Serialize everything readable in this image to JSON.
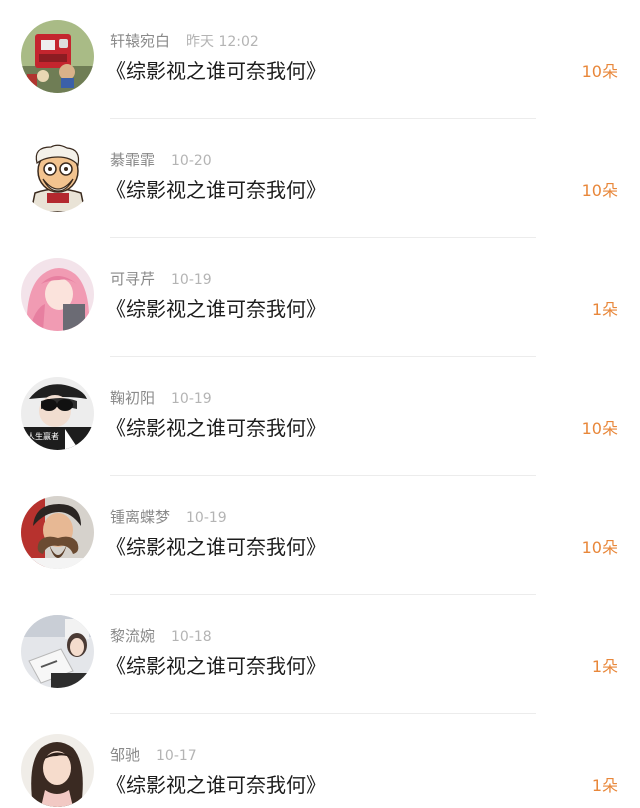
{
  "comments": [
    {
      "user": "轩辕宛白",
      "time": "昨天 12:02",
      "work": "《综影视之谁可奈我何》",
      "gift": "10朵",
      "avatar": "toy-figures-avatar"
    },
    {
      "user": "綦霏霏",
      "time": "10-20",
      "work": "《综影视之谁可奈我何》",
      "gift": "10朵",
      "avatar": "cartoon-old-man-avatar"
    },
    {
      "user": "可寻芹",
      "time": "10-19",
      "work": "《综影视之谁可奈我何》",
      "gift": "1朵",
      "avatar": "pink-hair-anime-girl-avatar"
    },
    {
      "user": "鞠初阳",
      "time": "10-19",
      "work": "《综影视之谁可奈我何》",
      "gift": "10朵",
      "avatar": "sunglasses-person-avatar"
    },
    {
      "user": "锺离蝶梦",
      "time": "10-19",
      "work": "《综影视之谁可奈我何》",
      "gift": "10朵",
      "avatar": "mustache-man-avatar"
    },
    {
      "user": "黎流婉",
      "time": "10-18",
      "work": "《综影视之谁可奈我何》",
      "gift": "1朵",
      "avatar": "woman-with-book-avatar"
    },
    {
      "user": "邹驰",
      "time": "10-17",
      "work": "《综影视之谁可奈我何》",
      "gift": "1朵",
      "avatar": "long-hair-woman-avatar"
    }
  ],
  "avatar_texts": {
    "row4": "人生赢者"
  },
  "colors": {
    "username": "#8a8a8a",
    "timestamp": "#b4b4b4",
    "title": "#1c1c1c",
    "gift": "#e8873a",
    "divider": "#ececec"
  }
}
